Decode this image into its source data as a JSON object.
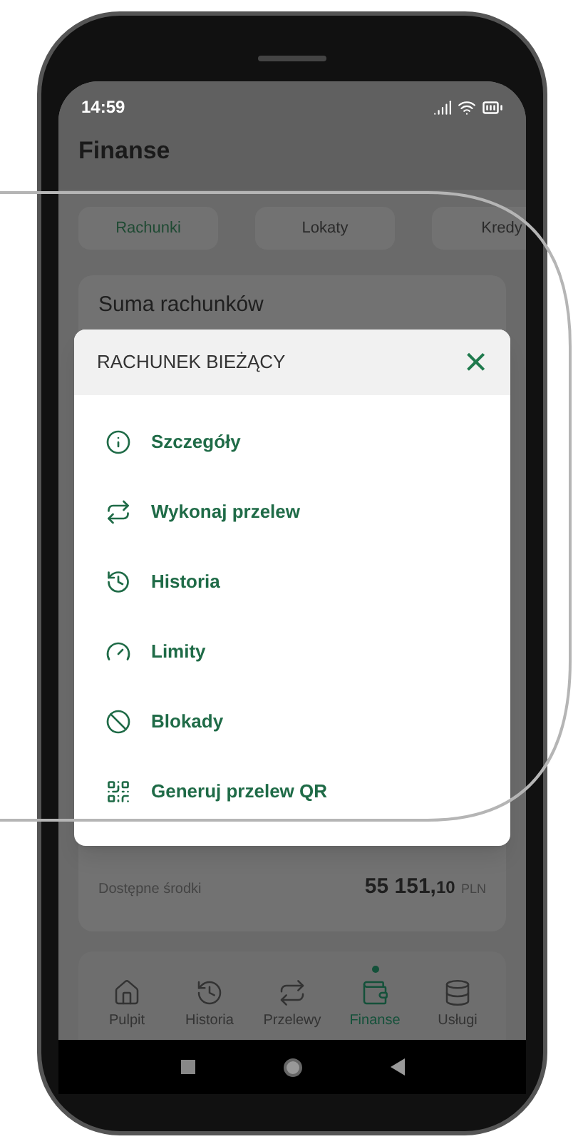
{
  "status_bar": {
    "time": "14:59"
  },
  "header": {
    "title": "Finanse"
  },
  "tabs": [
    {
      "label": "Rachunki",
      "selected": true
    },
    {
      "label": "Lokaty",
      "selected": false
    },
    {
      "label": "Kredy",
      "selected": false
    }
  ],
  "card": {
    "title": "Suma rachunków",
    "available_label": "Dostępne środki",
    "available_amount": "55 151,",
    "available_decimals": "10",
    "available_currency": "PLN"
  },
  "dialog": {
    "title": "RACHUNEK BIEŻĄCY",
    "close": "×",
    "items": [
      {
        "kind": "details",
        "label": "Szczegóły"
      },
      {
        "kind": "transfer",
        "label": "Wykonaj przelew"
      },
      {
        "kind": "history",
        "label": "Historia"
      },
      {
        "kind": "limits",
        "label": "Limity"
      },
      {
        "kind": "blocks",
        "label": "Blokady"
      },
      {
        "kind": "qr",
        "label": "Generuj przelew QR"
      }
    ]
  },
  "bottom_nav": [
    {
      "kind": "home",
      "label": "Pulpit",
      "selected": false
    },
    {
      "kind": "history",
      "label": "Historia",
      "selected": false
    },
    {
      "kind": "transfer",
      "label": "Przelewy",
      "selected": false
    },
    {
      "kind": "wallet",
      "label": "Finanse",
      "selected": true
    },
    {
      "kind": "services",
      "label": "Usługi",
      "selected": false
    }
  ]
}
